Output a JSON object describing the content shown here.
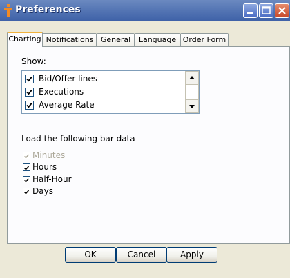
{
  "window": {
    "title": "Preferences",
    "controls": {
      "minimize": "minimize-icon",
      "maximize": "maximize-icon",
      "close": "close-icon"
    }
  },
  "tabs": [
    {
      "label": "Charting",
      "active": true
    },
    {
      "label": "Notifications",
      "active": false
    },
    {
      "label": "General",
      "active": false
    },
    {
      "label": "Language",
      "active": false
    },
    {
      "label": "Order Form",
      "active": false
    }
  ],
  "show_section": {
    "label": "Show:",
    "items": [
      {
        "label": "Bid/Offer lines",
        "checked": true
      },
      {
        "label": "Executions",
        "checked": true
      },
      {
        "label": "Average Rate",
        "checked": true
      }
    ]
  },
  "bar_data_section": {
    "label": "Load the following bar data",
    "items": [
      {
        "label": "Minutes",
        "checked": true,
        "enabled": false
      },
      {
        "label": "Hours",
        "checked": true,
        "enabled": true
      },
      {
        "label": "Half-Hour",
        "checked": true,
        "enabled": true
      },
      {
        "label": "Days",
        "checked": true,
        "enabled": true
      }
    ]
  },
  "buttons": {
    "ok": "OK",
    "cancel": "Cancel",
    "apply": "Apply"
  },
  "colors": {
    "title_bar": "#4f70b3",
    "tab_highlight": "#f1b23d",
    "close_button": "#c8482a",
    "disabled_text": "#aca899"
  }
}
